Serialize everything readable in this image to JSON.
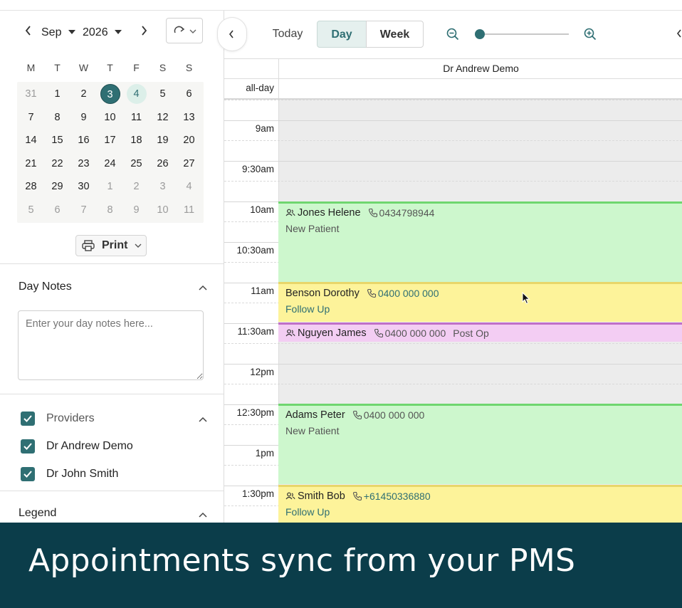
{
  "mini_calendar": {
    "month": "Sep",
    "year": "2026",
    "weekdays": [
      "M",
      "T",
      "W",
      "T",
      "F",
      "S",
      "S"
    ],
    "weeks": [
      [
        "31",
        "1",
        "2",
        "3",
        "4",
        "5",
        "6"
      ],
      [
        "7",
        "8",
        "9",
        "10",
        "11",
        "12",
        "13"
      ],
      [
        "14",
        "15",
        "16",
        "17",
        "18",
        "19",
        "20"
      ],
      [
        "21",
        "22",
        "23",
        "24",
        "25",
        "26",
        "27"
      ],
      [
        "28",
        "29",
        "30",
        "1",
        "2",
        "3",
        "4"
      ],
      [
        "5",
        "6",
        "7",
        "8",
        "9",
        "10",
        "11"
      ]
    ],
    "selected_day": "3",
    "highlighted_day": "4"
  },
  "print_button": {
    "label": "Print"
  },
  "day_notes": {
    "title": "Day Notes",
    "placeholder": "Enter your day notes here..."
  },
  "providers": {
    "title": "Providers",
    "items": [
      "Dr Andrew Demo",
      "Dr John Smith"
    ]
  },
  "legend": {
    "title": "Legend"
  },
  "toolbar": {
    "today": "Today",
    "day": "Day",
    "week": "Week",
    "zoom_level": 0
  },
  "calendar": {
    "provider_column": "Dr Andrew Demo",
    "allday_label": "all-day",
    "time_labels": [
      "9am",
      "9:30am",
      "10am",
      "10:30am",
      "11am",
      "11:30am",
      "12pm",
      "12:30pm",
      "1pm",
      "1:30pm"
    ]
  },
  "appointments": [
    {
      "first": "Jones",
      "last": "Helene",
      "phone": "0434798944",
      "type": "New Patient",
      "color": "#cdf7cd",
      "border": "#6fd66f",
      "has_person_icon": true
    },
    {
      "first": "Benson",
      "last": "Dorothy",
      "phone": "0400 000 000",
      "type": "Follow Up",
      "color": "#fdf39a",
      "border": "#e8d66a",
      "has_person_icon": false
    },
    {
      "first": "Nguyen",
      "last": "James",
      "phone": "0400 000 000",
      "type": "Post Op",
      "color": "#f3cdf3",
      "border": "#c070c8",
      "has_person_icon": true
    },
    {
      "first": "Adams",
      "last": "Peter",
      "phone": "0400 000 000",
      "type": "New Patient",
      "color": "#cdf7cd",
      "border": "#6fd66f",
      "has_person_icon": false
    },
    {
      "first": "Smith",
      "last": "Bob",
      "phone": "+61450336880",
      "type": "Follow Up",
      "color": "#fdf39a",
      "border": "#e8d66a",
      "has_person_icon": true
    }
  ],
  "colors": {
    "accent": "#2f6f73",
    "banner": "#0b3d4a",
    "closed_hours": "#ececec"
  },
  "banner": {
    "text": "Appointments sync from your PMS"
  }
}
